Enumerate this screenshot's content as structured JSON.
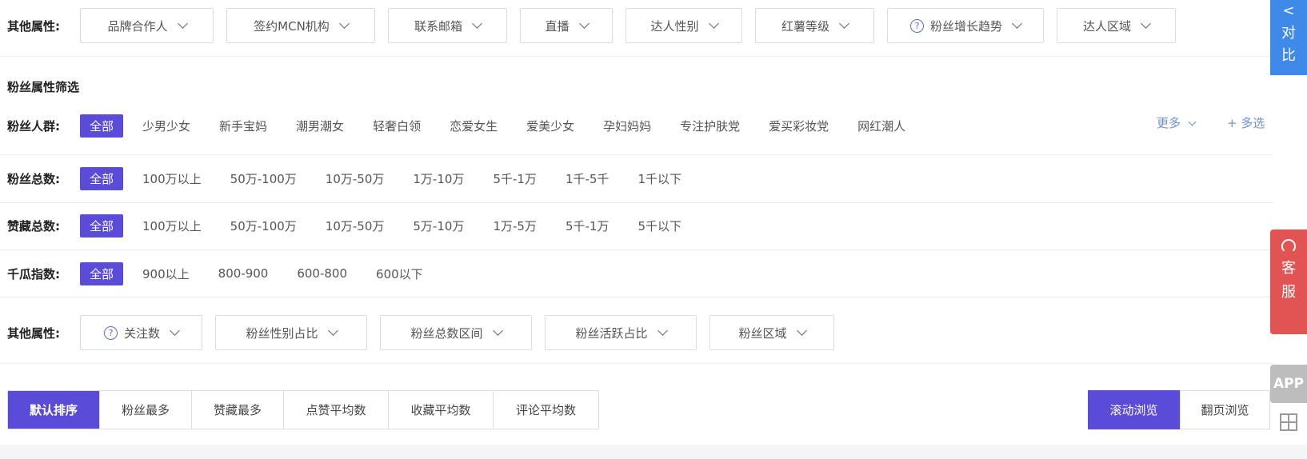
{
  "top_filters": {
    "label": "其他属性:",
    "items": [
      {
        "label": "品牌合作人",
        "help": false
      },
      {
        "label": "签约MCN机构",
        "help": false
      },
      {
        "label": "联系邮箱",
        "help": false
      },
      {
        "label": "直播",
        "help": false
      },
      {
        "label": "达人性别",
        "help": false
      },
      {
        "label": "红薯等级",
        "help": false
      },
      {
        "label": "粉丝增长趋势",
        "help": true
      },
      {
        "label": "达人区域",
        "help": false
      }
    ]
  },
  "section_title": "粉丝属性筛选",
  "crowd": {
    "label": "粉丝人群:",
    "options": [
      "全部",
      "少男少女",
      "新手宝妈",
      "潮男潮女",
      "轻奢白领",
      "恋爱女生",
      "爱美少女",
      "孕妇妈妈",
      "专注护肤党",
      "爱买彩妆党",
      "网红潮人"
    ],
    "more_label": "更多",
    "multi_label": "+ 多选"
  },
  "fans_total": {
    "label": "粉丝总数:",
    "options": [
      "全部",
      "100万以上",
      "50万-100万",
      "10万-50万",
      "1万-10万",
      "5千-1万",
      "1千-5千",
      "1千以下"
    ]
  },
  "likes_total": {
    "label": "赞藏总数:",
    "options": [
      "全部",
      "100万以上",
      "50万-100万",
      "10万-50万",
      "5万-10万",
      "1万-5万",
      "5千-1万",
      "5千以下"
    ]
  },
  "qiangua_index": {
    "label": "千瓜指数:",
    "options": [
      "全部",
      "900以上",
      "800-900",
      "600-800",
      "600以下"
    ]
  },
  "fan_filters": {
    "label": "其他属性:",
    "items": [
      {
        "label": "关注数",
        "help": true
      },
      {
        "label": "粉丝性别占比",
        "help": false
      },
      {
        "label": "粉丝总数区间",
        "help": false
      },
      {
        "label": "粉丝活跃占比",
        "help": false
      },
      {
        "label": "粉丝区域",
        "help": false
      }
    ]
  },
  "sort": {
    "options": [
      "默认排序",
      "粉丝最多",
      "赞藏最多",
      "点赞平均数",
      "收藏平均数",
      "评论平均数"
    ]
  },
  "view": {
    "scroll_label": "滚动浏览",
    "page_label": "翻页浏览"
  },
  "side": {
    "compare_chars": [
      "<",
      "对",
      "比"
    ],
    "service_chars": [
      "客",
      "服"
    ],
    "app_label": "APP"
  },
  "colors": {
    "accent": "#5a4bd8",
    "compare": "#3f8ae8",
    "service": "#e25454",
    "link": "#6f8fe0"
  }
}
